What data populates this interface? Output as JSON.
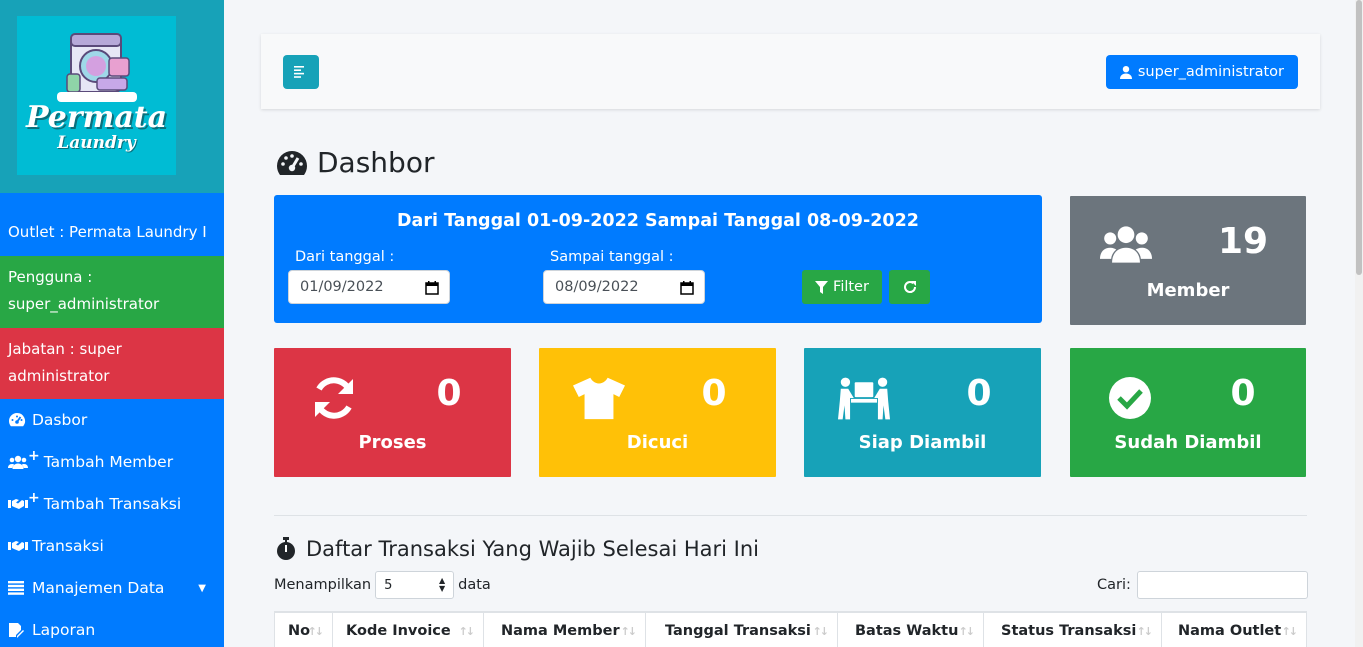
{
  "logo": {
    "title": "Permata",
    "subtitle": "Laundry"
  },
  "sidebar": {
    "outlet": "Outlet : Permata Laundry I",
    "user_label": "Pengguna :",
    "user_value": "super_administrator",
    "role_label": "Jabatan : super",
    "role_value": "administrator",
    "items": [
      {
        "label": "Dasbor",
        "icon": "tachometer-icon"
      },
      {
        "label": "Tambah Member",
        "icon": "users-plus-icon"
      },
      {
        "label": "Tambah Transaksi",
        "icon": "handshake-plus-icon"
      },
      {
        "label": "Transaksi",
        "icon": "handshake-icon"
      },
      {
        "label": "Manajemen Data",
        "icon": "list-icon"
      },
      {
        "label": "Laporan",
        "icon": "report-icon"
      }
    ]
  },
  "topbar": {
    "user_button": "super_administrator"
  },
  "page": {
    "title": "Dashbor"
  },
  "filter": {
    "title": "Dari Tanggal 01-09-2022 Sampai Tanggal 08-09-2022",
    "from_label": "Dari tanggal :",
    "from_value": "01/09/2022",
    "to_label": "Sampai tanggal :",
    "to_value": "08/09/2022",
    "filter_button": "Filter"
  },
  "stats": {
    "member": {
      "value": "19",
      "label": "Member",
      "color": "#6c757d"
    },
    "proses": {
      "value": "0",
      "label": "Proses",
      "color": "#dc3545"
    },
    "dicuci": {
      "value": "0",
      "label": "Dicuci",
      "color": "#ffc107"
    },
    "siap": {
      "value": "0",
      "label": "Siap Diambil",
      "color": "#17a2b8"
    },
    "sudah": {
      "value": "0",
      "label": "Sudah Diambil",
      "color": "#28a745"
    }
  },
  "section": {
    "title": "Daftar Transaksi Yang Wajib Selesai Hari Ini"
  },
  "table_controls": {
    "show_prefix": "Menampilkan",
    "show_value": "5",
    "show_suffix": "data",
    "search_label": "Cari:"
  },
  "table": {
    "columns": [
      "No",
      "Kode Invoice",
      "Nama Member",
      "Tanggal Transaksi",
      "Batas Waktu",
      "Status Transaksi",
      "Nama Outlet"
    ]
  }
}
